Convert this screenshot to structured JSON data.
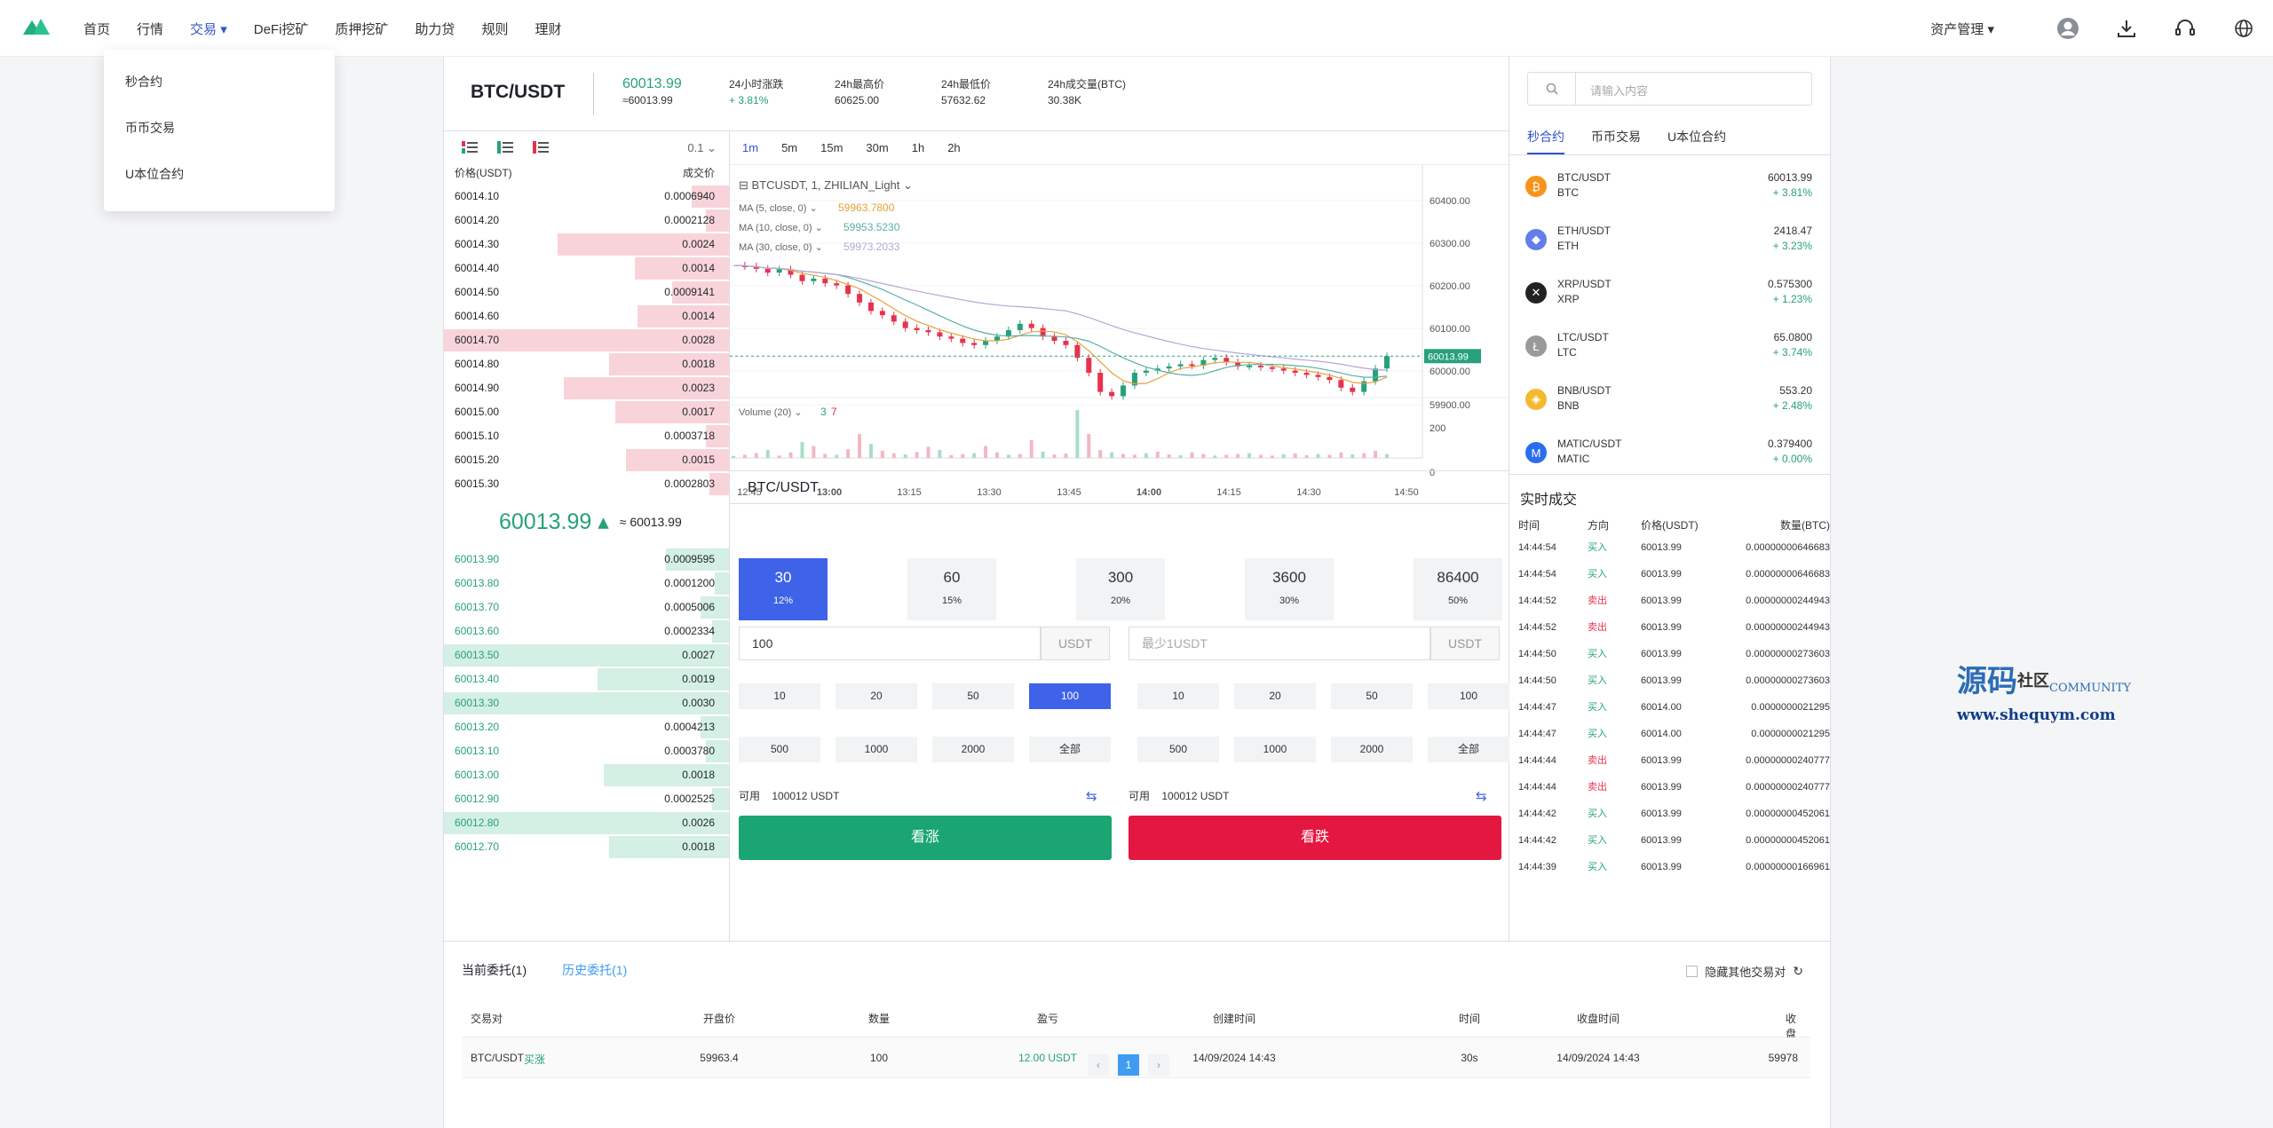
{
  "nav": {
    "items": [
      "首页",
      "行情",
      "交易",
      "DeFi挖矿",
      "质押挖矿",
      "助力贷",
      "规则",
      "理财"
    ],
    "active": "交易",
    "asset": "资产管理"
  },
  "dropdown": [
    "秒合约",
    "币币交易",
    "U本位合约"
  ],
  "ticker": {
    "pair": "BTC/USDT",
    "price": "60013.99",
    "price_sub": "≈60013.99",
    "change_label": "24小时涨跌",
    "change": "+ 3.81%",
    "high_label": "24h最高价",
    "high": "60625.00",
    "low_label": "24h最低价",
    "low": "57632.62",
    "vol_label": "24h成交量(BTC)",
    "vol": "30.38K"
  },
  "orderbook": {
    "depth": "0.1",
    "price_header": "价格(USDT)",
    "vol_header": "成交价",
    "asks": [
      [
        "60014.10",
        "0.0006940",
        0.13
      ],
      [
        "60014.20",
        "0.0002128",
        0.08
      ],
      [
        "60014.30",
        "0.0024",
        0.6
      ],
      [
        "60014.40",
        "0.0014",
        0.33
      ],
      [
        "60014.50",
        "0.0009141",
        0.2
      ],
      [
        "60014.60",
        "0.0014",
        0.32
      ],
      [
        "60014.70",
        "0.0028",
        1.0
      ],
      [
        "60014.80",
        "0.0018",
        0.42
      ],
      [
        "60014.90",
        "0.0023",
        0.58
      ],
      [
        "60015.00",
        "0.0017",
        0.4
      ],
      [
        "60015.10",
        "0.0003718",
        0.08
      ],
      [
        "60015.20",
        "0.0015",
        0.36
      ],
      [
        "60015.30",
        "0.0002803",
        0.07
      ]
    ],
    "mid": "60013.99",
    "mid_sub": "≈ 60013.99",
    "bids": [
      [
        "60013.90",
        "0.0009595",
        0.22
      ],
      [
        "60013.80",
        "0.0001200",
        0.05
      ],
      [
        "60013.70",
        "0.0005006",
        0.1
      ],
      [
        "60013.60",
        "0.0002334",
        0.06
      ],
      [
        "60013.50",
        "0.0027",
        1.0
      ],
      [
        "60013.40",
        "0.0019",
        0.46
      ],
      [
        "60013.30",
        "0.0030",
        1.0
      ],
      [
        "60013.20",
        "0.0004213",
        0.1
      ],
      [
        "60013.10",
        "0.0003780",
        0.08
      ],
      [
        "60013.00",
        "0.0018",
        0.44
      ],
      [
        "60012.90",
        "0.0002525",
        0.06
      ],
      [
        "60012.80",
        "0.0026",
        1.0
      ],
      [
        "60012.70",
        "0.0018",
        0.42
      ]
    ]
  },
  "chart": {
    "timeframes": [
      "1m",
      "5m",
      "15m",
      "30m",
      "1h",
      "2h"
    ],
    "symbol": "BTCUSDT, 1, ZHILIAN_Light",
    "ma5": "MA (5, close, 0)",
    "ma5v": "59963.7800",
    "ma10": "MA (10, close, 0)",
    "ma10v": "59953.5230",
    "ma30": "MA (30, close, 0)",
    "ma30v": "59973.2033",
    "volume": "Volume (20)",
    "vol_a": "3",
    "vol_b": "7",
    "yticks": [
      "60400.00",
      "60300.00",
      "60200.00",
      "60100.00",
      "60000.00",
      "59900.00"
    ],
    "last": "60013.99",
    "vticks": [
      "200",
      "0"
    ],
    "xticks": [
      "12:45",
      "13:00",
      "13:15",
      "13:30",
      "13:45",
      "14:00",
      "14:15",
      "14:30",
      "14:50"
    ]
  },
  "trade": {
    "pair": "BTC/USDT",
    "periods": [
      [
        "30",
        "12%"
      ],
      [
        "60",
        "15%"
      ],
      [
        "300",
        "20%"
      ],
      [
        "3600",
        "30%"
      ],
      [
        "86400",
        "50%"
      ]
    ],
    "amount": "100",
    "unit": "USDT",
    "placeholder": "最少1USDT",
    "quick": [
      "10",
      "20",
      "50",
      "100",
      "500",
      "1000",
      "2000",
      "全部"
    ],
    "avail_label": "可用",
    "avail": "100012 USDT",
    "up": "看涨",
    "down": "看跌"
  },
  "right": {
    "search": "请输入内容",
    "tabs": [
      "秒合约",
      "币币交易",
      "U本位合约"
    ],
    "markets": [
      [
        "BTC/USDT",
        "BTC",
        "60013.99",
        "+ 3.81%",
        "#f7931a",
        "₿"
      ],
      [
        "ETH/USDT",
        "ETH",
        "2418.47",
        "+ 3.23%",
        "#627eea",
        "◆"
      ],
      [
        "XRP/USDT",
        "XRP",
        "0.575300",
        "+ 1.23%",
        "#222222",
        "✕"
      ],
      [
        "LTC/USDT",
        "LTC",
        "65.0800",
        "+ 3.74%",
        "#9a9a9a",
        "Ł"
      ],
      [
        "BNB/USDT",
        "BNB",
        "553.20",
        "+ 2.48%",
        "#f3ba2f",
        "◈"
      ],
      [
        "MATIC/USDT",
        "MATIC",
        "0.379400",
        "+ 0.00%",
        "#2b6def",
        "M"
      ]
    ],
    "trades_title": "实时成交",
    "trades_head": [
      "时间",
      "方向",
      "价格(USDT)",
      "数量(BTC)"
    ],
    "trades": [
      [
        "14:44:54",
        "买入",
        "60013.99",
        "0.00000000646683"
      ],
      [
        "14:44:54",
        "买入",
        "60013.99",
        "0.00000000646683"
      ],
      [
        "14:44:52",
        "卖出",
        "60013.99",
        "0.00000000244943"
      ],
      [
        "14:44:52",
        "卖出",
        "60013.99",
        "0.00000000244943"
      ],
      [
        "14:44:50",
        "买入",
        "60013.99",
        "0.00000000273603"
      ],
      [
        "14:44:50",
        "买入",
        "60013.99",
        "0.00000000273603"
      ],
      [
        "14:44:47",
        "买入",
        "60014.00",
        "0.0000000021295"
      ],
      [
        "14:44:47",
        "买入",
        "60014.00",
        "0.0000000021295"
      ],
      [
        "14:44:44",
        "卖出",
        "60013.99",
        "0.00000000240777"
      ],
      [
        "14:44:44",
        "卖出",
        "60013.99",
        "0.00000000240777"
      ],
      [
        "14:44:42",
        "买入",
        "60013.99",
        "0.00000000452061"
      ],
      [
        "14:44:42",
        "买入",
        "60013.99",
        "0.00000000452061"
      ],
      [
        "14:44:39",
        "买入",
        "60013.99",
        "0.00000000166961"
      ]
    ]
  },
  "orders": {
    "tab_current": "当前委托(1)",
    "tab_history": "历史委托(1)",
    "hide_label": "隐藏其他交易对",
    "head": [
      "交易对",
      "开盘价",
      "数量",
      "盈亏",
      "创建时间",
      "时间",
      "收盘时间",
      "收盘价"
    ],
    "row": [
      "BTC/USDT",
      "买涨",
      "59963.4",
      "100",
      "12.00 USDT",
      "14/09/2024 14:43",
      "30s",
      "14/09/2024 14:43",
      "59978"
    ],
    "page": "1"
  },
  "watermark": {
    "cn": "源码",
    "cn2": "社区",
    "en": "COMMUNITY",
    "url": "www.shequym.com"
  }
}
